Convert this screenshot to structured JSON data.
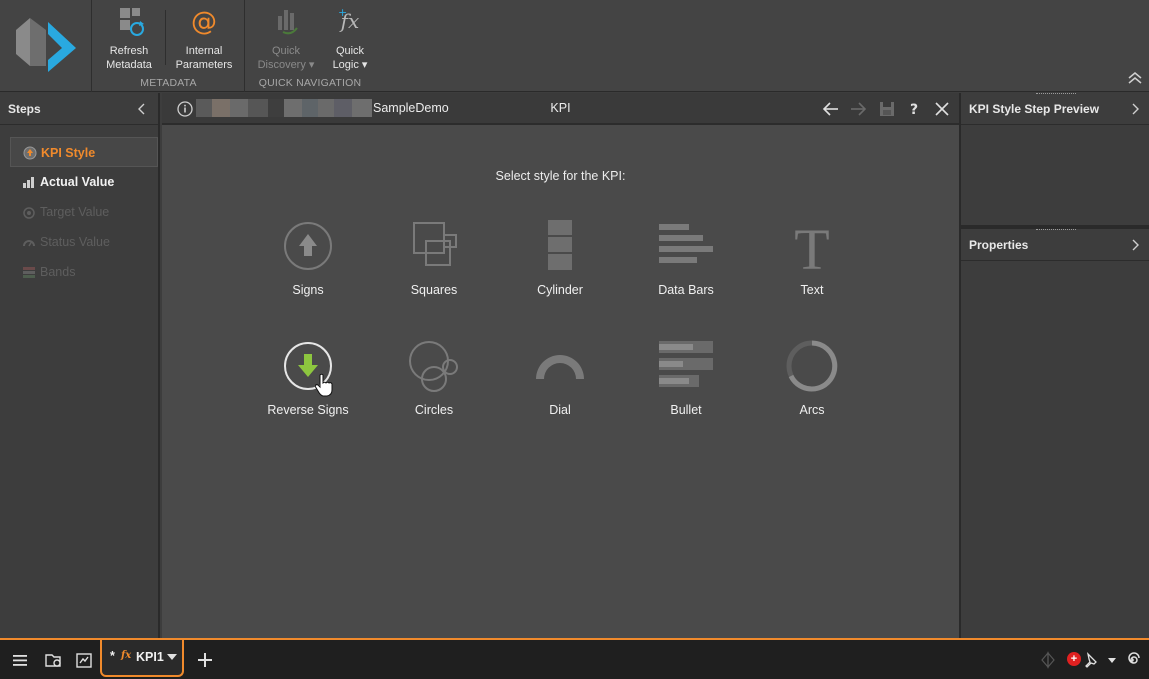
{
  "ribbon": {
    "groups": [
      {
        "label": "METADATA",
        "buttons": [
          {
            "label1": "Refresh",
            "label2": "Metadata",
            "icon": "refresh-metadata-icon",
            "enabled": true
          },
          {
            "label1": "Internal",
            "label2": "Parameters",
            "icon": "at-sign-icon",
            "enabled": true
          }
        ]
      },
      {
        "label": "QUICK NAVIGATION",
        "buttons": [
          {
            "label1": "Quick",
            "label2": "Discovery ▾",
            "icon": "quick-discovery-icon",
            "enabled": false
          },
          {
            "label1": "Quick",
            "label2": "Logic ▾",
            "icon": "fx-icon",
            "enabled": true
          }
        ]
      }
    ]
  },
  "steps": {
    "title": "Steps",
    "items": [
      {
        "label": "KPI Style",
        "state": "active"
      },
      {
        "label": "Actual Value",
        "state": "enabled"
      },
      {
        "label": "Target Value",
        "state": "disabled"
      },
      {
        "label": "Status Value",
        "state": "disabled"
      },
      {
        "label": "Bands",
        "state": "disabled"
      }
    ]
  },
  "editor": {
    "source_name": "SampleDemo",
    "title": "KPI",
    "prompt": "Select style for the KPI:",
    "styles": [
      {
        "label": "Signs",
        "icon": "up-arrow-circle-icon"
      },
      {
        "label": "Squares",
        "icon": "squares-icon"
      },
      {
        "label": "Cylinder",
        "icon": "cylinder-icon"
      },
      {
        "label": "Data Bars",
        "icon": "data-bars-icon"
      },
      {
        "label": "Text",
        "icon": "text-t-icon"
      },
      {
        "label": "Reverse Signs",
        "icon": "down-arrow-circle-icon",
        "hovered": true
      },
      {
        "label": "Circles",
        "icon": "circles-icon"
      },
      {
        "label": "Dial",
        "icon": "dial-icon"
      },
      {
        "label": "Bullet",
        "icon": "bullet-icon"
      },
      {
        "label": "Arcs",
        "icon": "arcs-icon"
      }
    ]
  },
  "right_panel": {
    "preview_title": "KPI Style Step Preview",
    "properties_title": "Properties"
  },
  "bottom": {
    "tab": {
      "modified": "*",
      "fx": "fx",
      "name": "KPI1"
    }
  },
  "colors": {
    "accent": "#f08a2c",
    "green": "#8dc63f",
    "logo_blue": "#29a9e0"
  }
}
